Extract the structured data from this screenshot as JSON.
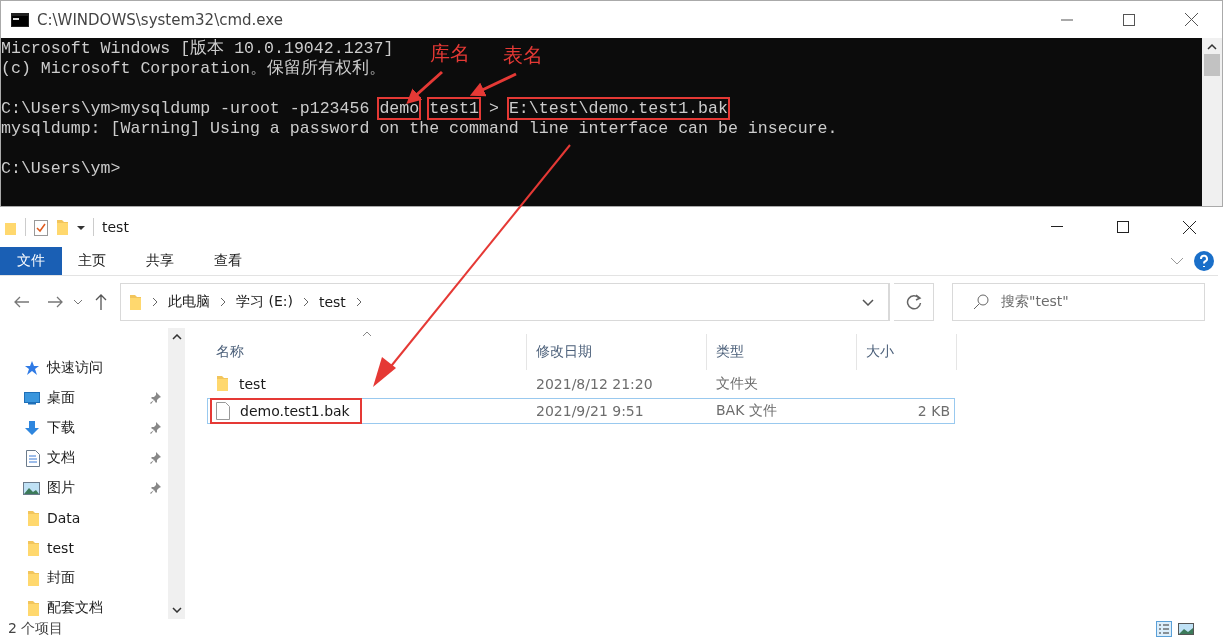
{
  "console": {
    "title": "C:\\WINDOWS\\system32\\cmd.exe",
    "lines": [
      {
        "blank_before": false,
        "segments": [
          {
            "text": "Microsoft Windows [版本 10.0.19042.1237]",
            "boxed": false
          }
        ]
      },
      {
        "blank_before": false,
        "segments": [
          {
            "text": "(c) Microsoft Corporation。保留所有权利。",
            "boxed": false
          }
        ]
      },
      {
        "blank_before": true,
        "segments": [
          {
            "text": "C:\\Users\\ym>mysqldump -uroot -p123456",
            "boxed": false
          },
          {
            "text": "demo",
            "boxed": true
          },
          {
            "text": "test1",
            "boxed": true
          },
          {
            "text": ">",
            "boxed": false
          },
          {
            "text": "E:\\test\\demo.test1.bak",
            "boxed": true
          }
        ]
      },
      {
        "blank_before": false,
        "segments": [
          {
            "text": "mysqldump: [Warning] Using a password on the command line interface can be insecure.",
            "boxed": false
          }
        ]
      },
      {
        "blank_before": true,
        "segments": [
          {
            "text": "C:\\Users\\ym>",
            "boxed": false
          }
        ]
      }
    ]
  },
  "annotations": [
    {
      "label": "库名"
    },
    {
      "label": "表名"
    }
  ],
  "explorer": {
    "title": "test",
    "ribbon_tabs": [
      {
        "label": "文件",
        "kind": "file"
      },
      {
        "label": "主页",
        "kind": "tab"
      },
      {
        "label": "共享",
        "kind": "tab"
      },
      {
        "label": "查看",
        "kind": "tab"
      }
    ],
    "breadcrumb": [
      "此电脑",
      "学习 (E:)",
      "test"
    ],
    "search": {
      "placeholder": "搜索\"test\""
    },
    "nav_items": [
      {
        "label": "快速访问",
        "kind": "star",
        "pinned": false
      },
      {
        "label": "桌面",
        "kind": "desktop",
        "pinned": true
      },
      {
        "label": "下载",
        "kind": "download",
        "pinned": true
      },
      {
        "label": "文档",
        "kind": "document",
        "pinned": true
      },
      {
        "label": "图片",
        "kind": "pictures",
        "pinned": true
      },
      {
        "label": "Data",
        "kind": "folder",
        "pinned": false
      },
      {
        "label": "test",
        "kind": "folder",
        "pinned": false
      },
      {
        "label": "封面",
        "kind": "folder",
        "pinned": false
      },
      {
        "label": "配套文档",
        "kind": "folder",
        "pinned": false
      }
    ],
    "columns": [
      {
        "label": "名称",
        "sorted": true
      },
      {
        "label": "修改日期",
        "sorted": false
      },
      {
        "label": "类型",
        "sorted": false
      },
      {
        "label": "大小",
        "sorted": false
      }
    ],
    "rows": [
      {
        "kind": "folder",
        "name": "test",
        "date": "2021/8/12 21:20",
        "type": "文件夹",
        "selected": false,
        "highlighted": false
      },
      {
        "kind": "file",
        "name": "demo.test1.bak",
        "date": "2021/9/21 9:51",
        "type": "BAK 文件",
        "size": "2 KB",
        "selected": true,
        "highlighted": true
      }
    ],
    "status": "2 个项目"
  }
}
